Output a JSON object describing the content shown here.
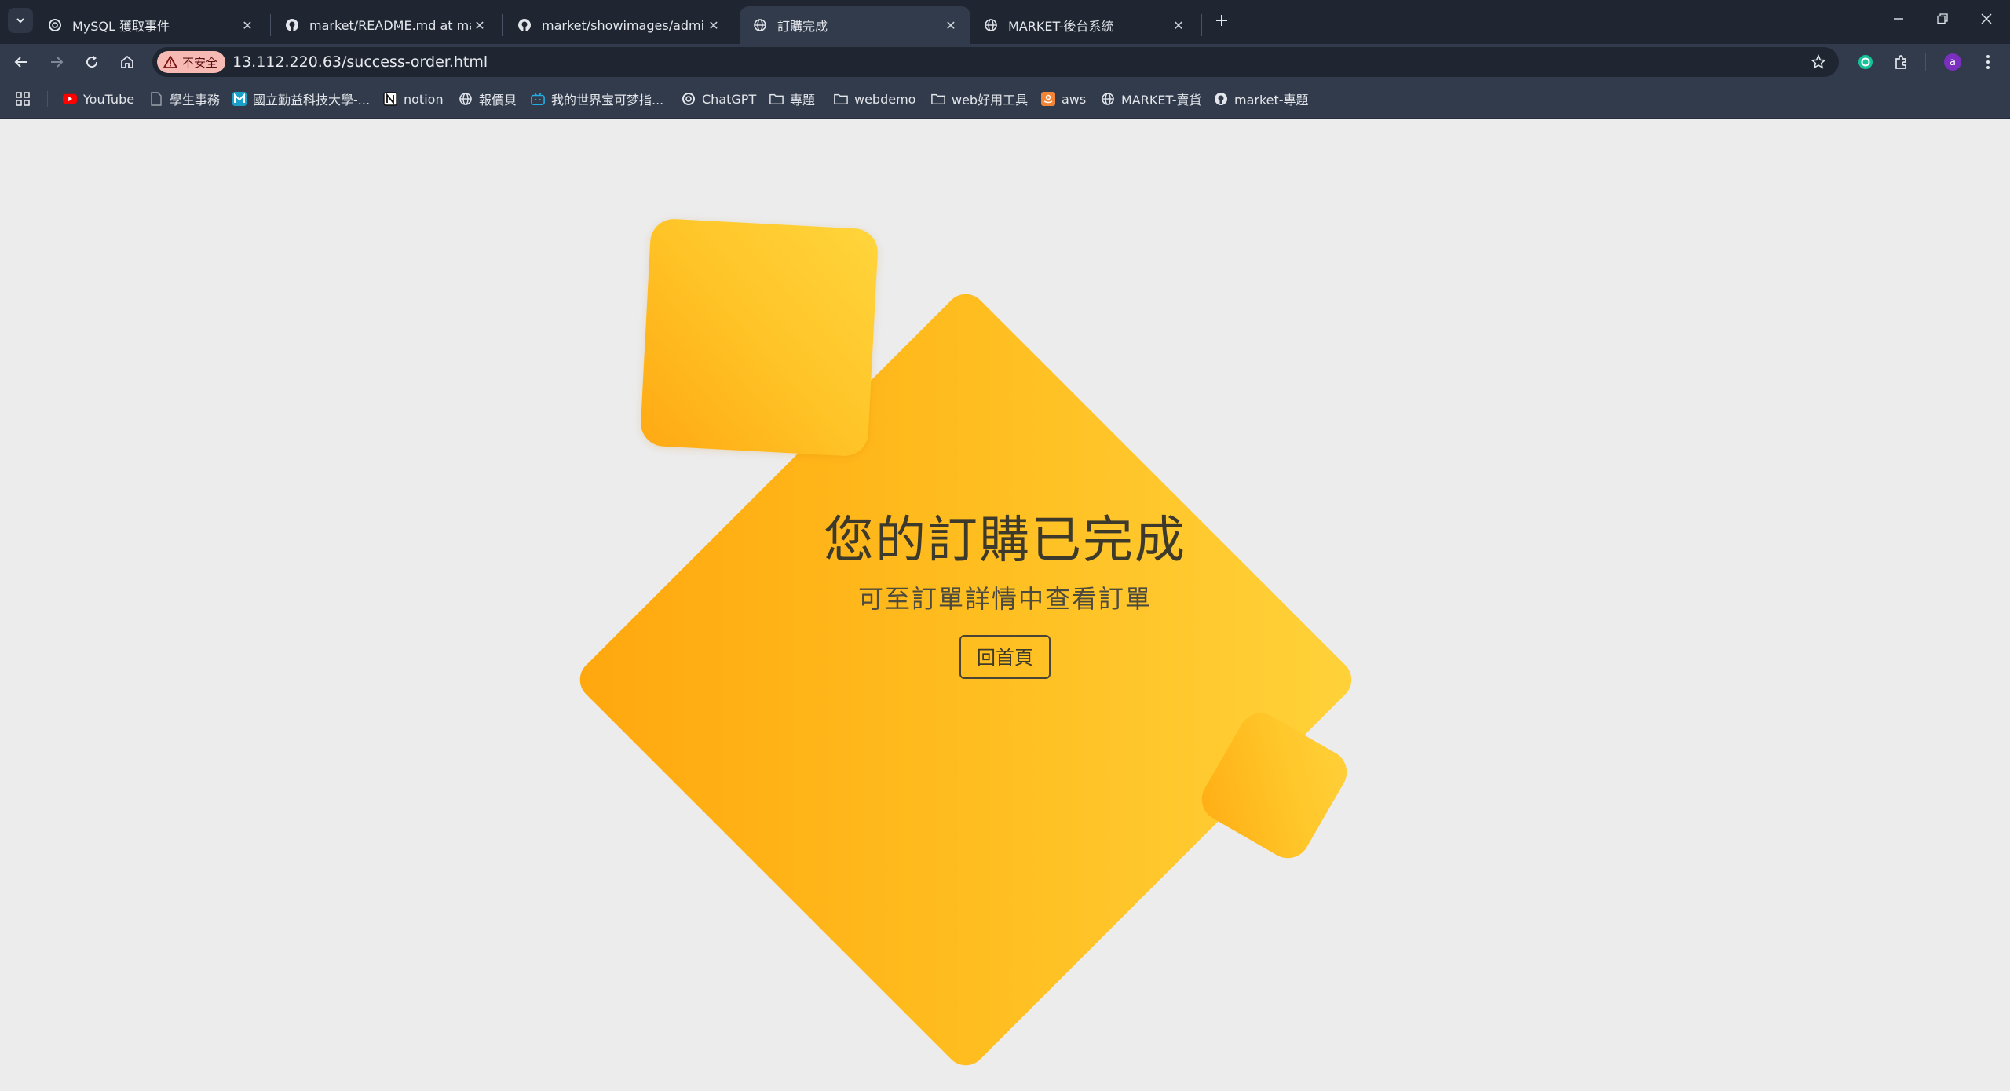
{
  "browser": {
    "tabs": [
      {
        "title": "MySQL 獲取事件",
        "icon": "openai-icon"
      },
      {
        "title": "market/README.md at main",
        "icon": "github-icon"
      },
      {
        "title": "market/showimages/admin-l",
        "icon": "github-icon"
      },
      {
        "title": "訂購完成",
        "icon": "globe-icon",
        "active": true
      },
      {
        "title": "MARKET-後台系統",
        "icon": "globe-icon"
      }
    ],
    "security_label": "不安全",
    "url": "13.112.220.63/success-order.html",
    "avatar_letter": "a",
    "bookmarks": [
      {
        "label": "YouTube",
        "icon": "youtube-icon"
      },
      {
        "label": "學生事務",
        "icon": "page-icon"
      },
      {
        "label": "國立勤益科技大學-...",
        "icon": "m-logo-icon"
      },
      {
        "label": "notion",
        "icon": "notion-icon"
      },
      {
        "label": "報價貝",
        "icon": "globe-icon"
      },
      {
        "label": "我的世界宝可梦指...",
        "icon": "bilibili-icon"
      },
      {
        "label": "ChatGPT",
        "icon": "openai-icon"
      },
      {
        "label": "專題",
        "icon": "folder-icon"
      },
      {
        "label": "webdemo",
        "icon": "folder-icon"
      },
      {
        "label": "web好用工具",
        "icon": "folder-icon"
      },
      {
        "label": "aws",
        "icon": "aws-icon"
      },
      {
        "label": "MARKET-賣貨",
        "icon": "globe-icon"
      },
      {
        "label": "market-專題",
        "icon": "github-icon"
      }
    ]
  },
  "page": {
    "headline": "您的訂購已完成",
    "subline": "可至訂單詳情中查看訂單",
    "home_button": "回首頁"
  },
  "colors": {
    "accent_orange": "#ffa70e",
    "accent_yellow": "#ffd23a",
    "page_bg": "#ececec"
  }
}
